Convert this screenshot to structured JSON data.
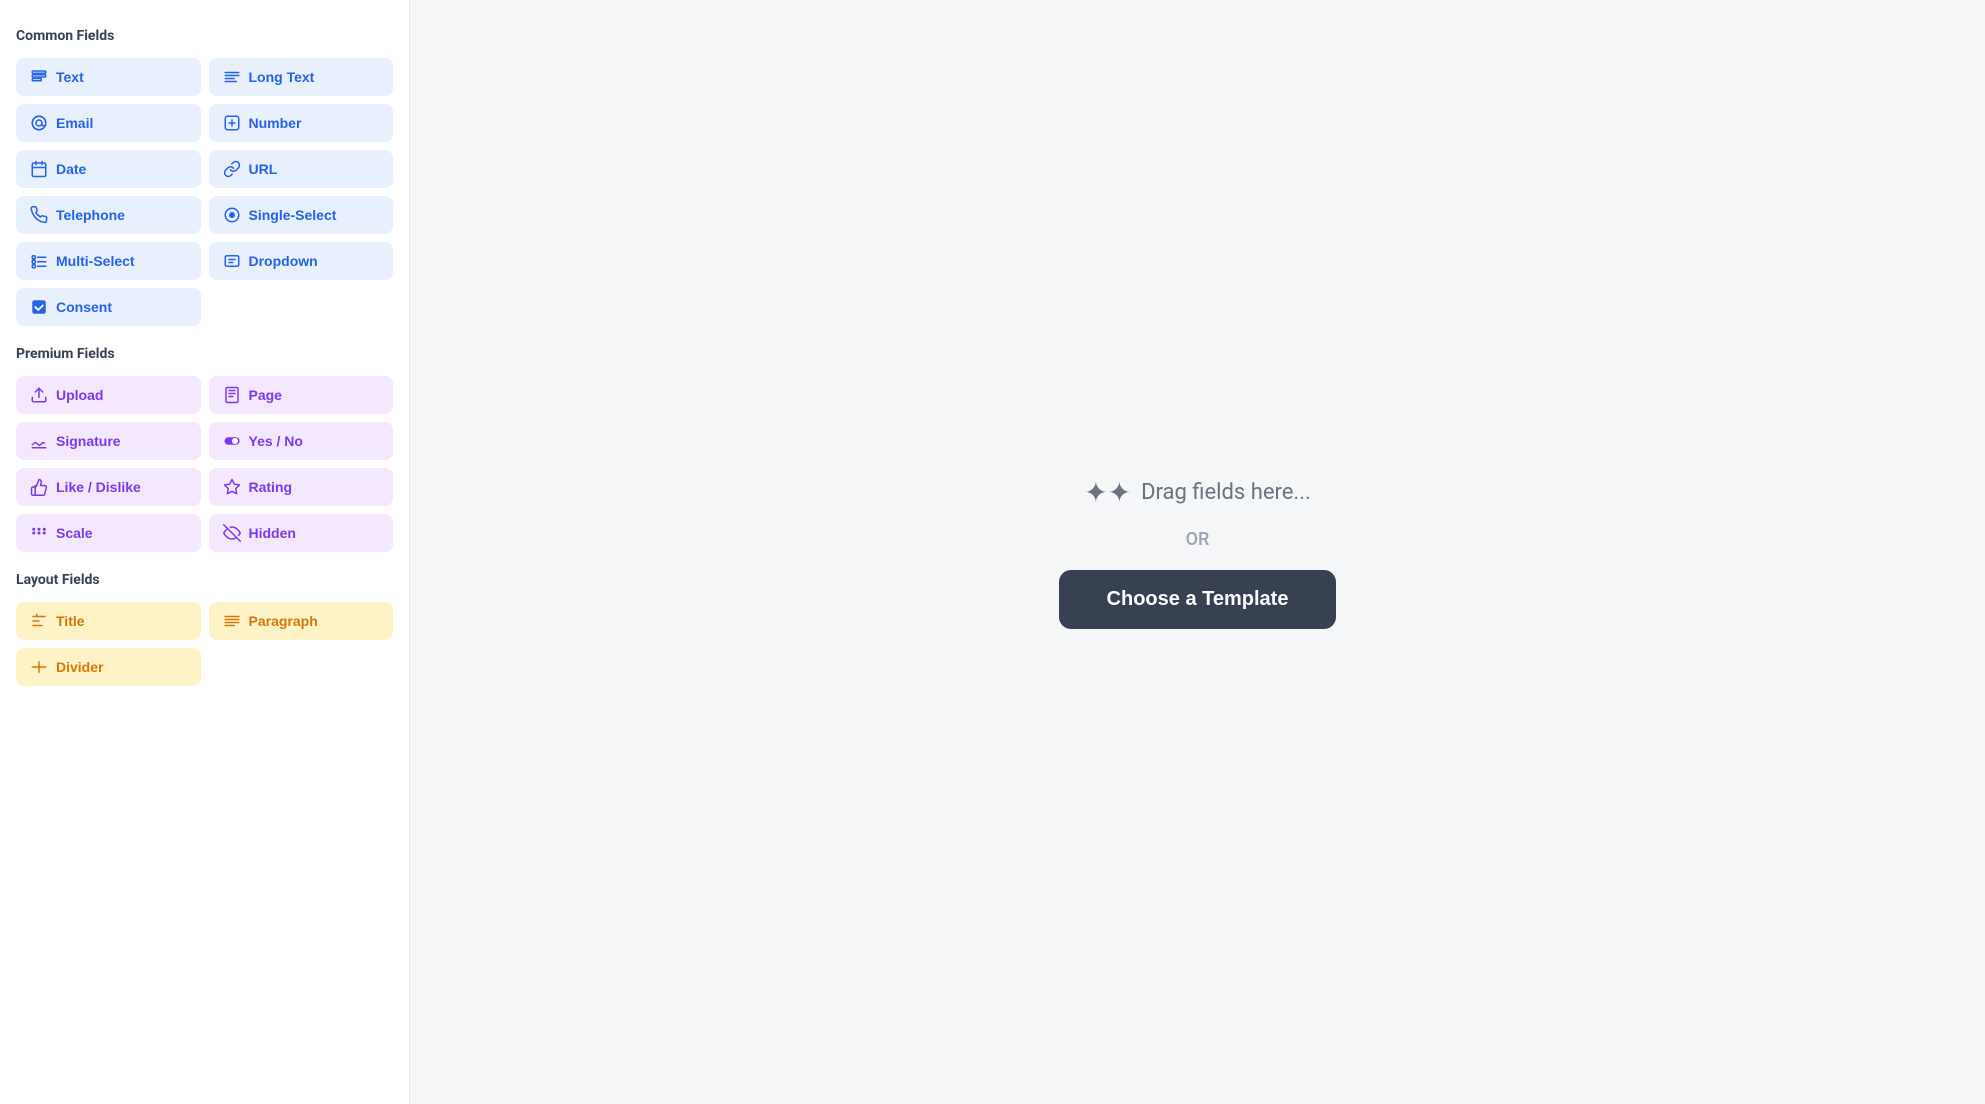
{
  "sidebar": {
    "sections": [
      {
        "id": "common",
        "title": "Common Fields",
        "type": "common",
        "fields": [
          {
            "id": "text",
            "label": "Text",
            "icon": "text"
          },
          {
            "id": "long-text",
            "label": "Long Text",
            "icon": "long-text"
          },
          {
            "id": "email",
            "label": "Email",
            "icon": "email"
          },
          {
            "id": "number",
            "label": "Number",
            "icon": "number"
          },
          {
            "id": "date",
            "label": "Date",
            "icon": "date"
          },
          {
            "id": "url",
            "label": "URL",
            "icon": "url"
          },
          {
            "id": "telephone",
            "label": "Telephone",
            "icon": "telephone"
          },
          {
            "id": "single-select",
            "label": "Single-Select",
            "icon": "single-select"
          },
          {
            "id": "multi-select",
            "label": "Multi-Select",
            "icon": "multi-select"
          },
          {
            "id": "dropdown",
            "label": "Dropdown",
            "icon": "dropdown"
          },
          {
            "id": "consent",
            "label": "Consent",
            "icon": "consent",
            "single": true
          }
        ]
      },
      {
        "id": "premium",
        "title": "Premium Fields",
        "type": "premium",
        "fields": [
          {
            "id": "upload",
            "label": "Upload",
            "icon": "upload"
          },
          {
            "id": "page",
            "label": "Page",
            "icon": "page"
          },
          {
            "id": "signature",
            "label": "Signature",
            "icon": "signature"
          },
          {
            "id": "yes-no",
            "label": "Yes / No",
            "icon": "yes-no"
          },
          {
            "id": "like-dislike",
            "label": "Like / Dislike",
            "icon": "like-dislike"
          },
          {
            "id": "rating",
            "label": "Rating",
            "icon": "rating"
          },
          {
            "id": "scale",
            "label": "Scale",
            "icon": "scale"
          },
          {
            "id": "hidden",
            "label": "Hidden",
            "icon": "hidden"
          }
        ]
      },
      {
        "id": "layout",
        "title": "Layout Fields",
        "type": "layout",
        "fields": [
          {
            "id": "title",
            "label": "Title",
            "icon": "title"
          },
          {
            "id": "paragraph",
            "label": "Paragraph",
            "icon": "paragraph"
          },
          {
            "id": "divider",
            "label": "Divider",
            "icon": "divider",
            "single": true
          }
        ]
      }
    ]
  },
  "main": {
    "drag_text": "Drag fields here...",
    "or_text": "OR",
    "choose_template_label": "Choose a Template"
  }
}
